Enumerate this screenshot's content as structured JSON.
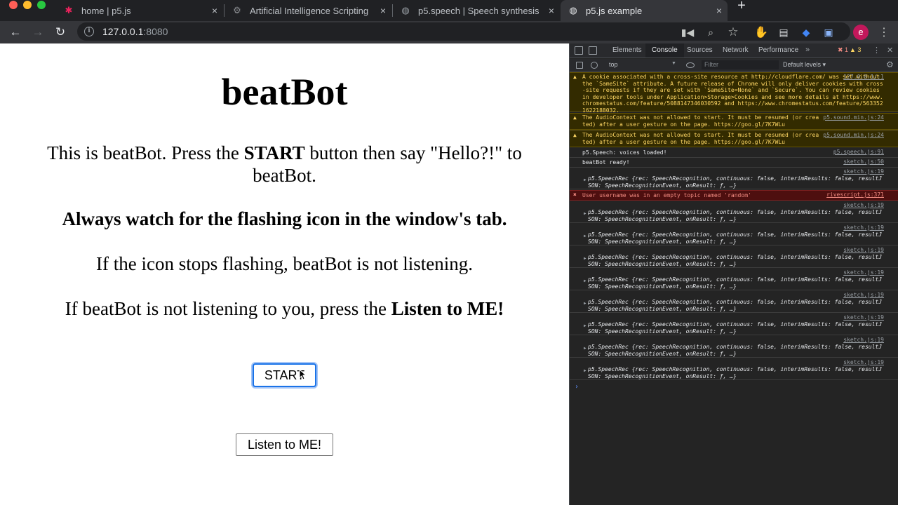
{
  "browser": {
    "tabs": [
      {
        "title": "home | p5.js",
        "favicon": "p5-star-icon",
        "active": false
      },
      {
        "title": "Artificial Intelligence Scripting",
        "favicon": "globe-icon",
        "active": false
      },
      {
        "title": "p5.speech | Speech synthesis",
        "favicon": "globe-icon",
        "active": false
      },
      {
        "title": "p5.js example",
        "favicon": "globe-icon",
        "active": true
      }
    ],
    "close_glyph": "×",
    "new_tab_glyph": "+",
    "url_host": "127.0.0.1",
    "url_port": ":8080",
    "profile_initial": "e"
  },
  "page": {
    "title": "beatBot",
    "intro_before": "This is beatBot. Press the ",
    "intro_strong": "START",
    "intro_after": " button then say \"Hello?!\" to beatBot.",
    "watch_note": "Always watch for the flashing icon in the window's tab.",
    "stop_note": "If the icon stops flashing, beatBot is not listening.",
    "listen_before": "If beatBot is not listening to you, press the ",
    "listen_strong": "Listen to ME!",
    "start_button": "START",
    "listen_button": "Listen to ME!"
  },
  "devtools": {
    "tabs": [
      "Elements",
      "Console",
      "Sources",
      "Network",
      "Performance"
    ],
    "more": "»",
    "error_count": "1",
    "warning_count": "3",
    "context": "top",
    "filter_placeholder": "Filter",
    "levels": "Default levels ▾",
    "messages": [
      {
        "type": "warn",
        "text": "A cookie associated with a cross-site resource at http://cloudflare.com/ was set without the `SameSite` attribute. A future release of Chrome will only deliver cookies with cross-site requests if they are set with `SameSite=None` and `Secure`. You can review cookies in developer tools under Application>Storage>Cookies and see more details at https://www.chromestatus.com/feature/5088147346030592 and https://www.chromestatus.com/feature/5633521622188032.",
        "source": "127.0.0.1/:1"
      },
      {
        "type": "warn",
        "text": "The AudioContext was not allowed to start. It must be resumed (or created) after a user gesture on the page. https://goo.gl/7K7WLu",
        "source": "p5.sound.min.js:24"
      },
      {
        "type": "warn",
        "text": "The AudioContext was not allowed to start. It must be resumed (or created) after a user gesture on the page. https://goo.gl/7K7WLu",
        "source": "p5.sound.min.js:24"
      },
      {
        "type": "log",
        "text": "p5.Speech: voices loaded!",
        "source": "p5.speech.js:91"
      },
      {
        "type": "log",
        "text": "beatBot ready!",
        "source": "sketch.js:50"
      },
      {
        "type": "obj",
        "text": "p5.SpeechRec {rec: SpeechRecognition, continuous: false, interimResults: false, resultJSON: SpeechRecognitionEvent, onResult: ƒ, …}",
        "source": "sketch.js:19"
      },
      {
        "type": "err",
        "text": "User username was in an empty topic named 'random'",
        "source": "rivescript.js:371"
      },
      {
        "type": "obj",
        "text": "p5.SpeechRec {rec: SpeechRecognition, continuous: false, interimResults: false, resultJSON: SpeechRecognitionEvent, onResult: ƒ, …}",
        "source": "sketch.js:19"
      },
      {
        "type": "obj",
        "text": "p5.SpeechRec {rec: SpeechRecognition, continuous: false, interimResults: false, resultJSON: SpeechRecognitionEvent, onResult: ƒ, …}",
        "source": "sketch.js:19"
      },
      {
        "type": "obj",
        "text": "p5.SpeechRec {rec: SpeechRecognition, continuous: false, interimResults: false, resultJSON: SpeechRecognitionEvent, onResult: ƒ, …}",
        "source": "sketch.js:19"
      },
      {
        "type": "obj",
        "text": "p5.SpeechRec {rec: SpeechRecognition, continuous: false, interimResults: false, resultJSON: SpeechRecognitionEvent, onResult: ƒ, …}",
        "source": "sketch.js:19"
      },
      {
        "type": "obj",
        "text": "p5.SpeechRec {rec: SpeechRecognition, continuous: false, interimResults: false, resultJSON: SpeechRecognitionEvent, onResult: ƒ, …}",
        "source": "sketch.js:19"
      },
      {
        "type": "obj",
        "text": "p5.SpeechRec {rec: SpeechRecognition, continuous: false, interimResults: false, resultJSON: SpeechRecognitionEvent, onResult: ƒ, …}",
        "source": "sketch.js:19"
      },
      {
        "type": "obj",
        "text": "p5.SpeechRec {rec: SpeechRecognition, continuous: false, interimResults: false, resultJSON: SpeechRecognitionEvent, onResult: ƒ, …}",
        "source": "sketch.js:19"
      },
      {
        "type": "obj",
        "text": "p5.SpeechRec {rec: SpeechRecognition, continuous: false, interimResults: false, resultJSON: SpeechRecognitionEvent, onResult: ƒ, …}",
        "source": "sketch.js:19"
      }
    ],
    "prompt": "›"
  },
  "colors": {
    "start_focus": "#1a73e8",
    "warn_bg": "#332b00",
    "error_bg": "#4e0f0f",
    "profile": "#c2185b"
  }
}
